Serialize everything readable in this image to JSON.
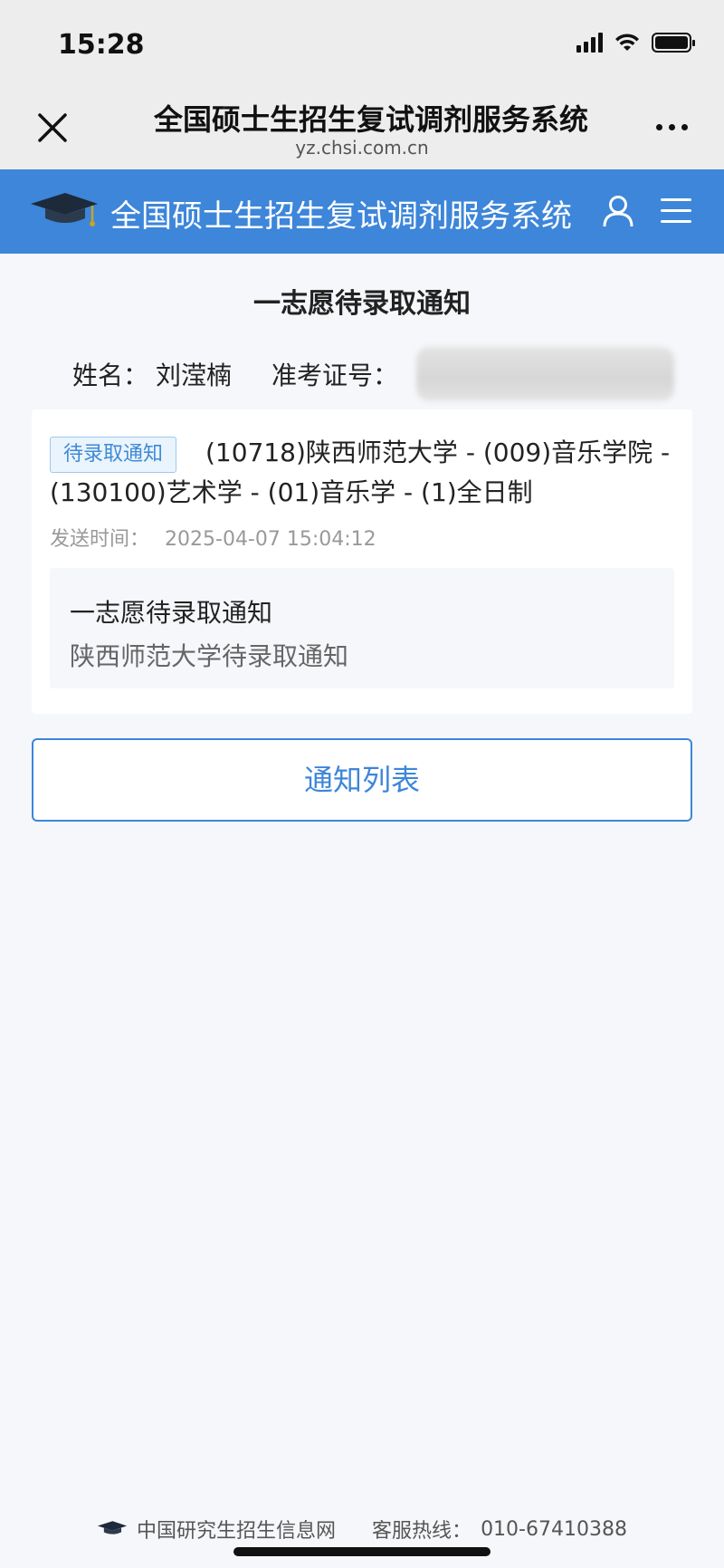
{
  "status_bar": {
    "time": "15:28"
  },
  "webview": {
    "title": "全国硕士生招生复试调剂服务系统",
    "domain": "yz.chsi.com.cn"
  },
  "site_header": {
    "title": "全国硕士生招生复试调剂服务系统"
  },
  "page": {
    "heading": "一志愿待录取通知",
    "name_label": "姓名：",
    "name_value": "刘滢楠",
    "exam_id_label": "准考证号："
  },
  "notice_card": {
    "badge": "待录取通知",
    "title": "(10718)陕西师范大学 - (009)音乐学院 - (130100)艺术学 - (01)音乐学 - (1)全日制",
    "send_time_label": "发送时间：",
    "send_time_value": "2025-04-07 15:04:12",
    "message_title": "一志愿待录取通知",
    "message_body": "陕西师范大学待录取通知"
  },
  "list_button": {
    "label": "通知列表"
  },
  "footer": {
    "site_name": "中国研究生招生信息网",
    "hotline_label": "客服热线：",
    "hotline_number": "010-67410388"
  },
  "colors": {
    "brand_blue": "#3d86d9",
    "badge_bg": "#eaf4fd",
    "badge_border": "#9ec7ee"
  },
  "icons": [
    "close-icon",
    "more-icon",
    "graduation-cap-icon",
    "user-icon",
    "menu-icon",
    "signal-icon",
    "wifi-icon",
    "battery-icon"
  ]
}
